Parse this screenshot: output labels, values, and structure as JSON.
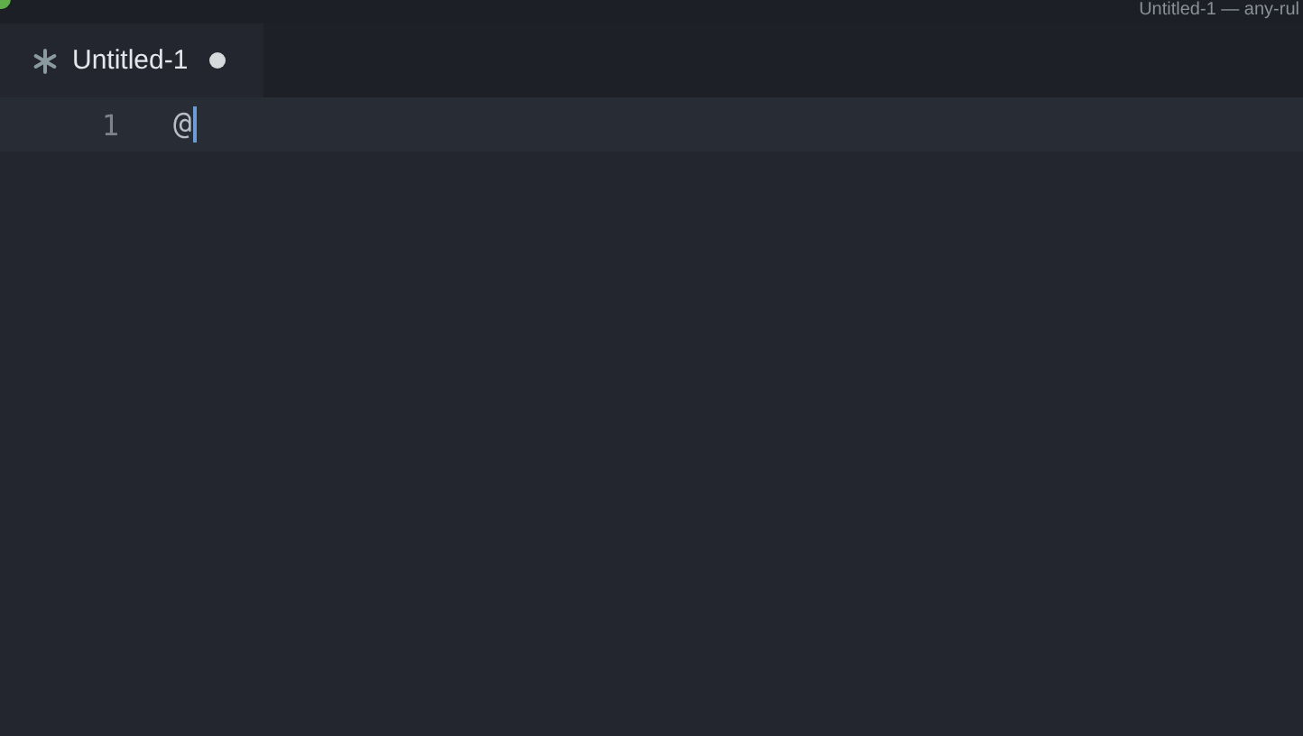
{
  "window": {
    "title": "Untitled-1 — any-rul"
  },
  "tabs": [
    {
      "label": "Untitled-1",
      "selected": true,
      "modified": true
    }
  ],
  "editor": {
    "lines": [
      {
        "number": "1",
        "text": "@",
        "current": true
      }
    ]
  }
}
